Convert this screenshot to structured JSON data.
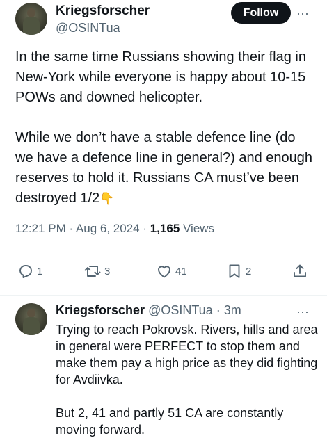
{
  "tweet": {
    "display_name": "Kriegsforscher",
    "handle": "@OSINTua",
    "follow_label": "Follow",
    "more_label": "···",
    "text_paragraph_1": "In the same time Russians showing their flag in New-York while everyone is happy about 10-15 POWs and downed helicopter.",
    "text_paragraph_2": "While we don’t have a stable defence line (do we have a defence line in general?) and enough reserves to hold it. Russians CA must’ve been destroyed 1/2",
    "emoji": "👇",
    "timestamp": "12:21 PM · Aug 6, 2024 · ",
    "views_count": "1,165",
    "views_label": " Views",
    "actions": {
      "replies": "1",
      "reposts": "3",
      "likes": "41",
      "bookmarks": "2"
    }
  },
  "reply": {
    "display_name": "Kriegsforscher",
    "handle_time": " @OSINTua · 3m",
    "more_label": "···",
    "text_paragraph_1": "Trying to reach Pokrovsk. Rivers, hills and area in general were PERFECT to stop them and make them pay a high price as they did fighting for Avdiivka.",
    "text_paragraph_2": "But 2, 41 and partly 51 CA are constantly moving forward."
  },
  "icons": {
    "reply": "reply-icon",
    "repost": "repost-icon",
    "like": "heart-icon",
    "bookmark": "bookmark-icon",
    "share": "share-icon"
  },
  "colors": {
    "text": "#0f1419",
    "secondary": "#536471",
    "follow_bg": "#0f1419",
    "divider": "#eff3f4"
  }
}
